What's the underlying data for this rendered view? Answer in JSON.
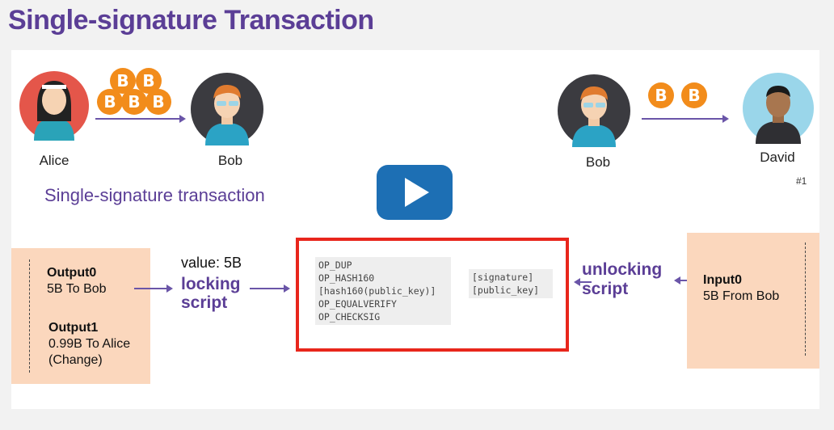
{
  "header": {
    "title": "Single-signature Transaction"
  },
  "people": {
    "alice": "Alice",
    "bob_left": "Bob",
    "bob_right": "Bob",
    "david": "David"
  },
  "coin_symbol": "B",
  "subtitle": "Single-signature transaction",
  "slide_number": "#1",
  "output_box": {
    "output0_title": "Output0",
    "output0_text": "5B To Bob",
    "output1_title": "Output1",
    "output1_line1": "0.99B To Alice",
    "output1_line2": "(Change)"
  },
  "value_label": "value: 5B",
  "locking_line1": "locking",
  "locking_line2": "script",
  "unlocking_line1": "unlocking",
  "unlocking_line2": "script",
  "script_locking": [
    "OP_DUP",
    "OP_HASH160",
    "[hash160(public_key)]",
    "OP_EQUALVERIFY",
    "OP_CHECKSIG"
  ],
  "script_unlocking": [
    "[signature]",
    "[public_key]"
  ],
  "input_box": {
    "input0_title": "Input0",
    "input0_text": "5B From Bob"
  },
  "colors": {
    "title": "#5b3e96",
    "coin": "#f28c1b",
    "box_fill": "#fbd7bd",
    "highlight_border": "#e8261c",
    "play_button": "#1d6fb4"
  },
  "video": {
    "play_icon": "play-icon"
  }
}
